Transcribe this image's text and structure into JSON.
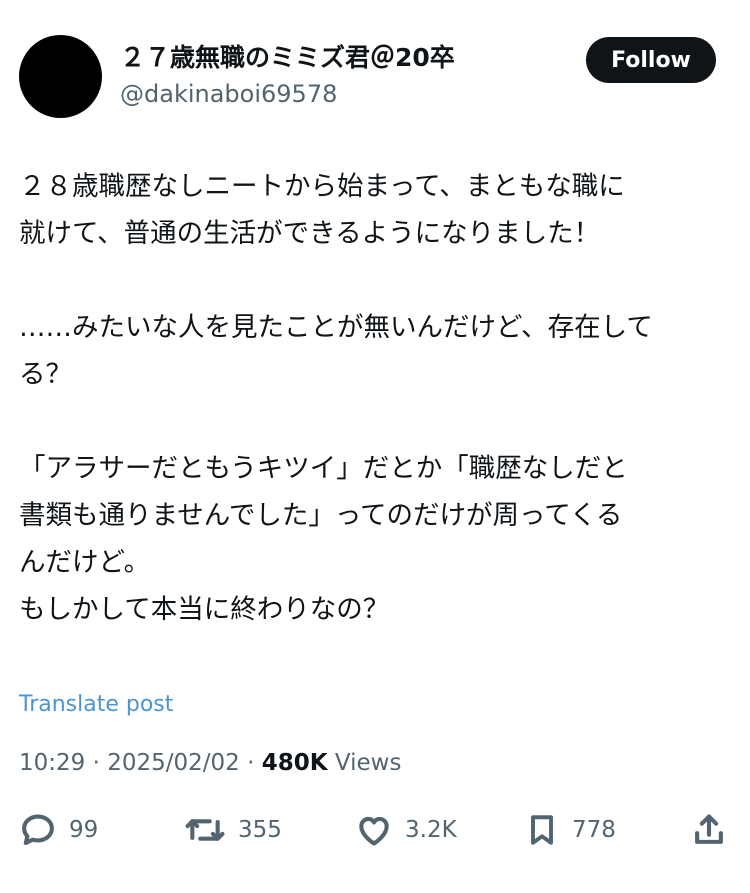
{
  "author": {
    "display_name": "２７歳無職のミミズ君＠20卒",
    "handle": "@dakinaboi69578"
  },
  "follow_label": "Follow",
  "post": {
    "lines": [
      "２８歳職歴なしニートから始まって、まともな職に",
      "就けて、普通の生活ができるようになりました！",
      "",
      "……みたいな人を見たことが無いんだけど、存在して",
      "る？",
      "",
      "「アラサーだともうキツイ」だとか「職歴なしだと",
      "書類も通りませんでした」ってのだけが周ってくる",
      "んだけど。",
      "もしかして本当に終わりなの？"
    ]
  },
  "translate_label": "Translate post",
  "meta": {
    "time": "10:29",
    "separator": "·",
    "date": "2025/02/02",
    "views_count": "480K",
    "views_label": "Views"
  },
  "actions": {
    "replies": "99",
    "reposts": "355",
    "likes": "3.2K",
    "bookmarks": "778"
  },
  "colors": {
    "text": "#0f1419",
    "secondary": "#536471",
    "link": "#4c95d1",
    "follow_bg": "#0f1419"
  },
  "icons": [
    "reply-icon",
    "repost-icon",
    "like-icon",
    "bookmark-icon",
    "share-icon"
  ]
}
